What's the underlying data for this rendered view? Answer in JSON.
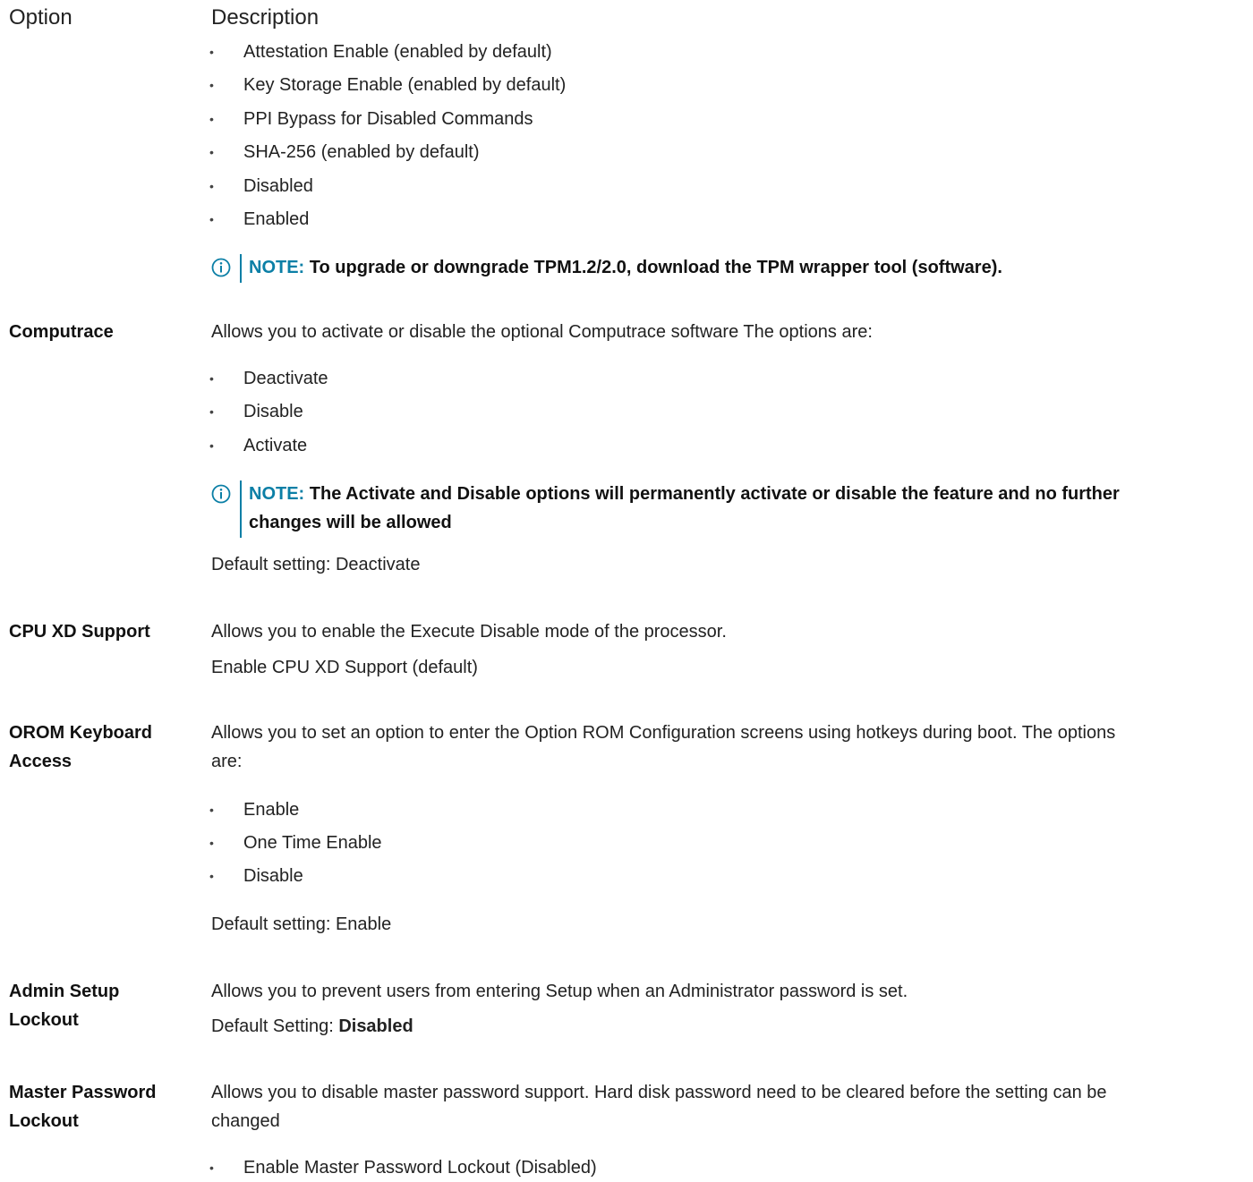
{
  "header": {
    "option": "Option",
    "description": "Description"
  },
  "tpm": {
    "items": [
      "Attestation Enable (enabled by default)",
      "Key Storage Enable (enabled by default)",
      "PPI Bypass for Disabled Commands",
      "SHA-256 (enabled by default)",
      "Disabled",
      "Enabled"
    ],
    "note_label": "NOTE:",
    "note_text": "To upgrade or downgrade TPM1.2/2.0, download the TPM wrapper tool (software)."
  },
  "computrace": {
    "label": "Computrace",
    "desc": "Allows you to activate or disable the optional Computrace software The options are:",
    "items": [
      "Deactivate",
      "Disable",
      "Activate"
    ],
    "note_label": "NOTE:",
    "note_line1": "The Activate and Disable options will permanently activate or disable the feature and no further",
    "note_line2": "changes will be allowed",
    "default": "Default setting: Deactivate"
  },
  "cpu_xd": {
    "label": "CPU XD Support",
    "desc": "Allows you to enable the Execute Disable mode of the processor.",
    "default": "Enable CPU XD Support (default)"
  },
  "orom": {
    "label_line1": "OROM Keyboard",
    "label_line2": "Access",
    "desc_line1": "Allows you to set an option to enter the Option ROM Configuration screens using hotkeys during boot. The options",
    "desc_line2": "are:",
    "items": [
      "Enable",
      "One Time Enable",
      "Disable"
    ],
    "default": "Default setting: Enable"
  },
  "admin_lockout": {
    "label_line1": "Admin Setup",
    "label_line2": "Lockout",
    "desc": "Allows you to prevent users from entering Setup when an Administrator password is set.",
    "default_prefix": "Default Setting: ",
    "default_value": "Disabled"
  },
  "master_pw": {
    "label_line1": "Master Password",
    "label_line2": "Lockout",
    "desc_line1": "Allows you to disable master password support. Hard disk password need to be cleared before the setting can be",
    "desc_line2": "changed",
    "items": [
      "Enable Master Password Lockout (Disabled)"
    ]
  },
  "icons": {
    "note": "info-circle-icon",
    "bullet": "bullet-dot"
  },
  "colors": {
    "accent": "#0b7fa6",
    "text": "#222222"
  }
}
